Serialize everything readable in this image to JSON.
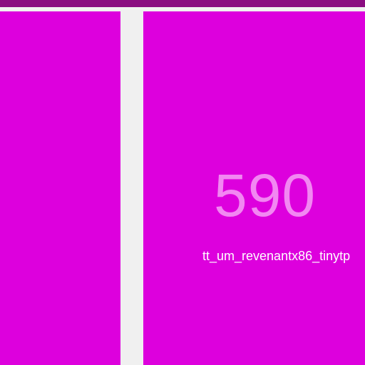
{
  "colors": {
    "tile": "#dd00dd",
    "top_bar": "#8a0c80",
    "gap": "#f0f0f0",
    "count_text": "#f287f2",
    "caption_text": "#ffffff"
  },
  "tiles": [
    {
      "name": "tile-left",
      "count": "",
      "caption": ""
    },
    {
      "name": "tile-right",
      "count": "590",
      "caption": "tt_um_revenantx86_tinytp"
    }
  ]
}
